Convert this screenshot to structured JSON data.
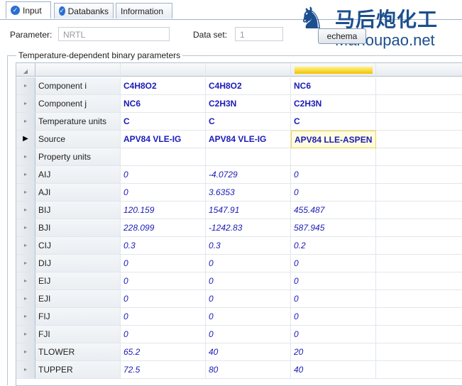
{
  "tabs": [
    {
      "label": "Input",
      "active": true,
      "icon": "check-circle-icon"
    },
    {
      "label": "Databanks",
      "active": false,
      "icon": "check-circle-icon"
    },
    {
      "label": "Information",
      "active": false
    }
  ],
  "watermark": {
    "cn": "马后炮化工",
    "en": "Mahoupao.net"
  },
  "parameter": {
    "label": "Parameter:",
    "value": "NRTL"
  },
  "dataset": {
    "label": "Data set:",
    "value": "1"
  },
  "schema_button": "echema",
  "group_title": "Temperature-dependent binary parameters",
  "rows": [
    {
      "label": "Component i",
      "values": [
        "C4H8O2",
        "C4H8O2",
        "NC6",
        ""
      ],
      "style": "bold"
    },
    {
      "label": "Component j",
      "values": [
        "NC6",
        "C2H3N",
        "C2H3N",
        ""
      ],
      "style": "bold"
    },
    {
      "label": "Temperature units",
      "values": [
        "C",
        "C",
        "C",
        ""
      ],
      "style": "bold"
    },
    {
      "label": "Source",
      "values": [
        "APV84 VLE-IG",
        "APV84 VLE-IG",
        "APV84 LLE-ASPEN",
        ""
      ],
      "style": "bold",
      "active": true
    },
    {
      "label": "Property units",
      "values": [
        "",
        "",
        "",
        ""
      ],
      "style": "bold"
    },
    {
      "label": "AIJ",
      "values": [
        "0",
        "-4.0729",
        "0",
        ""
      ],
      "style": "italic"
    },
    {
      "label": "AJI",
      "values": [
        "0",
        "3.6353",
        "0",
        ""
      ],
      "style": "italic"
    },
    {
      "label": "BIJ",
      "values": [
        "120.159",
        "1547.91",
        "455.487",
        ""
      ],
      "style": "italic"
    },
    {
      "label": "BJI",
      "values": [
        "228.099",
        "-1242.83",
        "587.945",
        ""
      ],
      "style": "italic"
    },
    {
      "label": "CIJ",
      "values": [
        "0.3",
        "0.3",
        "0.2",
        ""
      ],
      "style": "italic"
    },
    {
      "label": "DIJ",
      "values": [
        "0",
        "0",
        "0",
        ""
      ],
      "style": "italic"
    },
    {
      "label": "EIJ",
      "values": [
        "0",
        "0",
        "0",
        ""
      ],
      "style": "italic"
    },
    {
      "label": "EJI",
      "values": [
        "0",
        "0",
        "0",
        ""
      ],
      "style": "italic"
    },
    {
      "label": "FIJ",
      "values": [
        "0",
        "0",
        "0",
        ""
      ],
      "style": "italic"
    },
    {
      "label": "FJI",
      "values": [
        "0",
        "0",
        "0",
        ""
      ],
      "style": "italic"
    },
    {
      "label": "TLOWER",
      "values": [
        "65.2",
        "40",
        "20",
        ""
      ],
      "style": "italic"
    },
    {
      "label": "TUPPER",
      "values": [
        "72.5",
        "80",
        "40",
        ""
      ],
      "style": "italic"
    }
  ]
}
